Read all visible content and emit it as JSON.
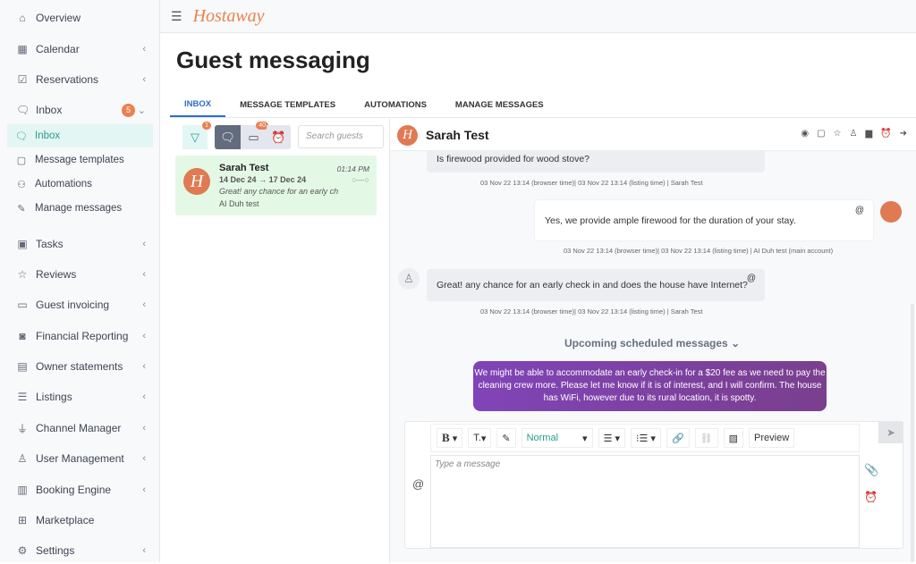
{
  "sidebar": {
    "items": [
      {
        "label": "Overview",
        "icon": "home-icon",
        "glyph": "⌂",
        "chevron": false
      },
      {
        "label": "Calendar",
        "icon": "calendar-icon",
        "glyph": "▦",
        "chevron": true
      },
      {
        "label": "Reservations",
        "icon": "calendar-check-icon",
        "glyph": "☑",
        "chevron": true
      },
      {
        "label": "Inbox",
        "icon": "chat-icon",
        "glyph": "🗨",
        "badge": "5"
      },
      {
        "label": "Tasks",
        "icon": "briefcase-icon",
        "glyph": "▣",
        "chevron": true
      },
      {
        "label": "Reviews",
        "icon": "star-icon",
        "glyph": "☆",
        "chevron": true
      },
      {
        "label": "Guest invoicing",
        "icon": "invoice-icon",
        "glyph": "▭",
        "chevron": true
      },
      {
        "label": "Financial Reporting",
        "icon": "money-icon",
        "glyph": "◙",
        "chevron": true
      },
      {
        "label": "Owner statements",
        "icon": "statement-icon",
        "glyph": "▤",
        "chevron": true
      },
      {
        "label": "Listings",
        "icon": "list-icon",
        "glyph": "☰",
        "chevron": true
      },
      {
        "label": "Channel Manager",
        "icon": "plug-icon",
        "glyph": "⏚",
        "chevron": true
      },
      {
        "label": "User Management",
        "icon": "user-icon",
        "glyph": "♙",
        "chevron": true
      },
      {
        "label": "Booking Engine",
        "icon": "layout-icon",
        "glyph": "▥",
        "chevron": true
      },
      {
        "label": "Marketplace",
        "icon": "marketplace-icon",
        "glyph": "⊞",
        "chevron": false
      },
      {
        "label": "Settings",
        "icon": "gear-icon",
        "glyph": "⚙",
        "chevron": true
      }
    ],
    "subitems": [
      {
        "label": "Inbox",
        "glyph": "🗨",
        "active": true
      },
      {
        "label": "Message templates",
        "glyph": "▢"
      },
      {
        "label": "Automations",
        "glyph": "⚇"
      },
      {
        "label": "Manage messages",
        "glyph": "✎"
      }
    ]
  },
  "topbar": {
    "logo": "Hostaway"
  },
  "page": {
    "title": "Guest messaging"
  },
  "tabs": [
    "INBOX",
    "MESSAGE TEMPLATES",
    "AUTOMATIONS",
    "MANAGE MESSAGES"
  ],
  "filters": {
    "filter_badge": "1",
    "archive_badge": "40",
    "search_placeholder": "Search guests"
  },
  "conversation": {
    "name": "Sarah Test",
    "dates_from": "14 Dec 24",
    "dates_to": "17 Dec 24",
    "arrow": "→",
    "time": "01:14 PM",
    "preview": "Great! any chance for an early ch",
    "listing": "AI Duh test",
    "avatar_letter": "H"
  },
  "chat": {
    "guest_name": "Sarah Test",
    "messages": [
      {
        "text": "Is firewood provided for wood stove?",
        "meta": "03 Nov 22 13:14 (browser time)| 03 Nov 22 13:14 (listing time) | Sarah Test"
      },
      {
        "text": "Yes, we provide ample firewood for the duration of your stay.",
        "meta": "03 Nov 22 13:14 (browser time)| 03 Nov 22 13:14 (listing time) | AI Duh test (main account)"
      },
      {
        "text": "Great! any chance for an early check in and does the house have Internet?",
        "meta": "03 Nov 22 13:14 (browser time)| 03 Nov 22 13:14 (listing time) | Sarah Test"
      }
    ],
    "scheduled_header": "Upcoming scheduled messages",
    "scheduled_text": "We might be able to accommodate an early check-in for a $20 fee as we need to pay the cleaning crew more. Please let me know if it is of interest, and I will confirm. The house has WiFi, however due to its rural location, it is spotty.",
    "scheduled_color": "#7d42a8"
  },
  "composer": {
    "bold": "B",
    "text_size": "T.",
    "style": "Normal",
    "preview": "Preview",
    "placeholder": "Type a message",
    "at": "@"
  }
}
